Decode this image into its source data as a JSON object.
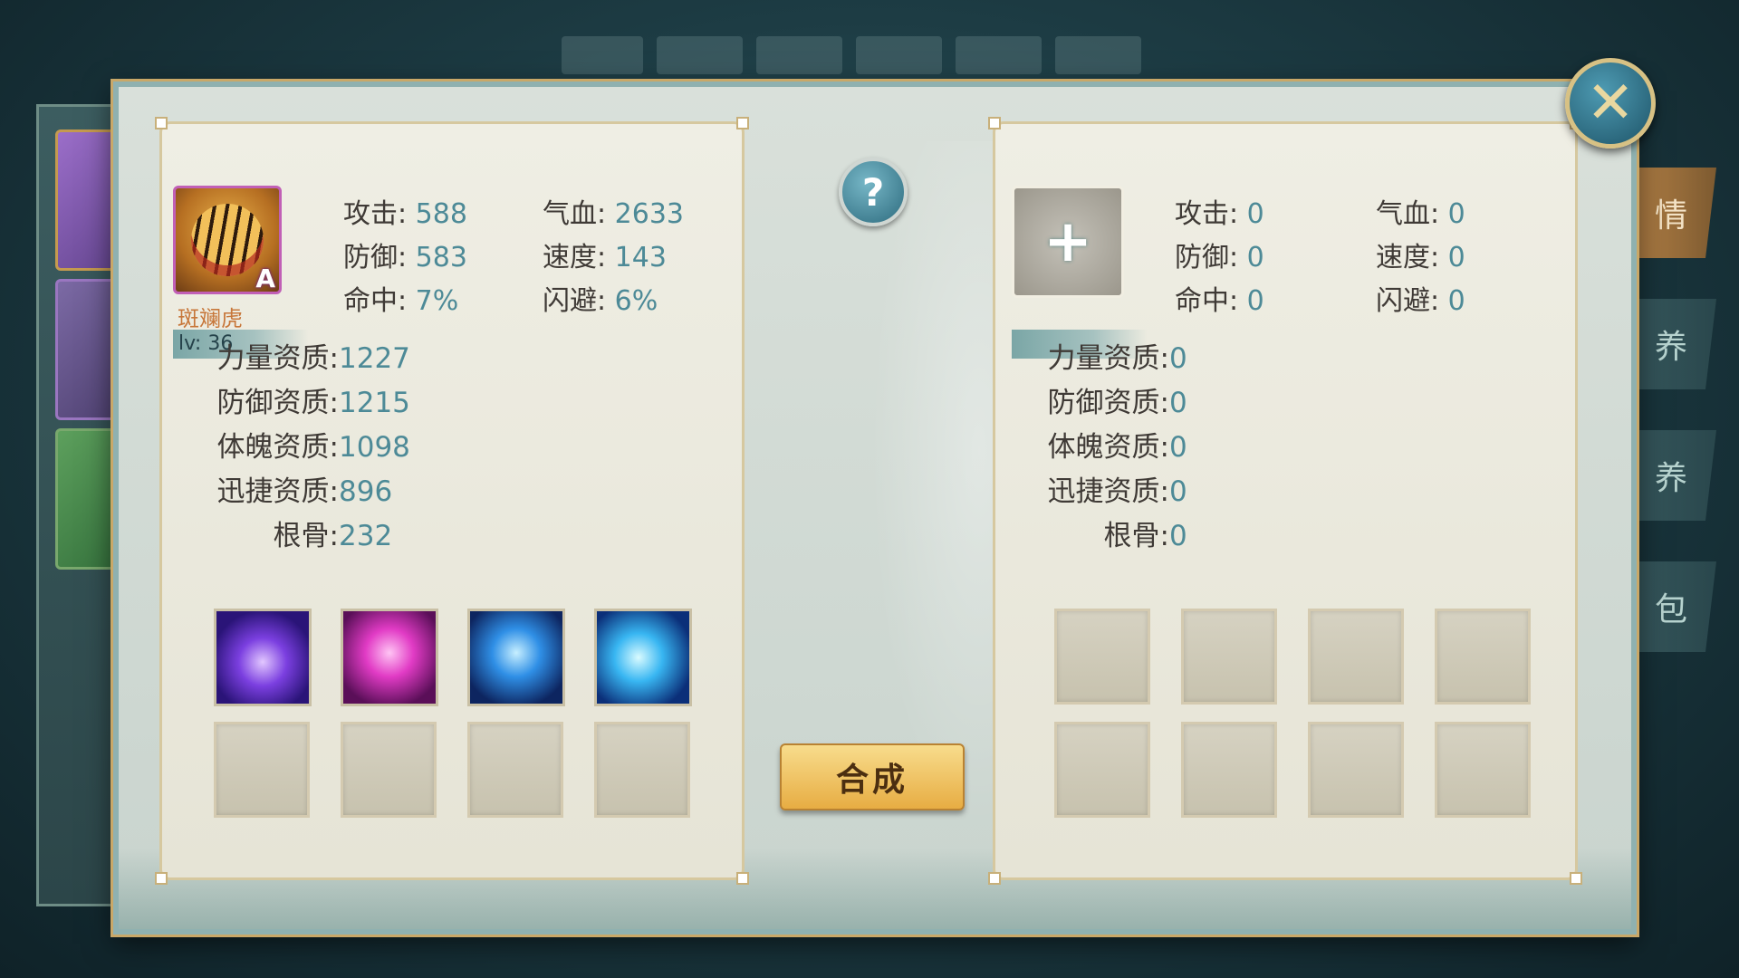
{
  "side_tabs": [
    {
      "label": "情",
      "active": true
    },
    {
      "label": "养",
      "active": false
    },
    {
      "label": "养",
      "active": false
    },
    {
      "label": "包",
      "active": false
    }
  ],
  "left_pet": {
    "name": "斑斓虎",
    "grade": "A",
    "level": "lv: 36",
    "icon": "tiger-portrait",
    "stats": {
      "attack": {
        "label": "攻击:",
        "value": "588"
      },
      "hp": {
        "label": "气血:",
        "value": "2633"
      },
      "defense": {
        "label": "防御:",
        "value": "583"
      },
      "speed": {
        "label": "速度:",
        "value": "143"
      },
      "hit": {
        "label": "命中:",
        "value": "7%"
      },
      "dodge": {
        "label": "闪避:",
        "value": "6%"
      }
    },
    "aptitudes": [
      {
        "label": "力量资质:",
        "value": "1227"
      },
      {
        "label": "防御资质:",
        "value": "1215"
      },
      {
        "label": "体魄资质:",
        "value": "1098"
      },
      {
        "label": "迅捷资质:",
        "value": "896"
      },
      {
        "label": "根骨:",
        "value": "232"
      }
    ],
    "skills": [
      {
        "icon": "purple-spiral-skill-icon"
      },
      {
        "icon": "pink-chain-skill-icon"
      },
      {
        "icon": "blue-chain-skill-icon"
      },
      {
        "icon": "blue-dragon-skill-icon"
      }
    ]
  },
  "right_pet": {
    "add_label": "+",
    "stats": {
      "attack": {
        "label": "攻击:",
        "value": "0"
      },
      "hp": {
        "label": "气血:",
        "value": "0"
      },
      "defense": {
        "label": "防御:",
        "value": "0"
      },
      "speed": {
        "label": "速度:",
        "value": "0"
      },
      "hit": {
        "label": "命中:",
        "value": "0"
      },
      "dodge": {
        "label": "闪避:",
        "value": "0"
      }
    },
    "aptitudes": [
      {
        "label": "力量资质:",
        "value": "0"
      },
      {
        "label": "防御资质:",
        "value": "0"
      },
      {
        "label": "体魄资质:",
        "value": "0"
      },
      {
        "label": "迅捷资质:",
        "value": "0"
      },
      {
        "label": "根骨:",
        "value": "0"
      }
    ]
  },
  "help_label": "?",
  "combine_label": "合成",
  "close_label": "✕",
  "colors": {
    "value": "#4d8a97",
    "label": "#3f3a36",
    "accent_gold": "#e7ad43",
    "name": "#c7773a"
  }
}
